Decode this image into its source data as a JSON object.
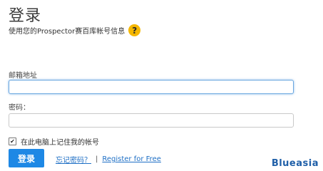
{
  "header": {
    "title": "登录",
    "subtitle": "使用您的Prospector赛百库帐号信息",
    "help_icon_glyph": "?"
  },
  "form": {
    "email_label": "邮箱地址",
    "email_value": "",
    "password_label": "密码：",
    "password_value": "",
    "remember_checked": true,
    "remember_label": "在此电脑上记住我的帐号",
    "login_button": "登录",
    "forgot_password_link": "忘记密码？",
    "separator": "|",
    "register_link": "Register for Free"
  },
  "brand": {
    "watermark": "Blueasia"
  },
  "colors": {
    "accent": "#1e88e5",
    "help_icon": "#f5b700",
    "link": "#1e6fc5",
    "brand": "#1f5fa8"
  },
  "icons": {
    "help": "question-mark-icon",
    "checkbox": "checkmark-icon"
  }
}
